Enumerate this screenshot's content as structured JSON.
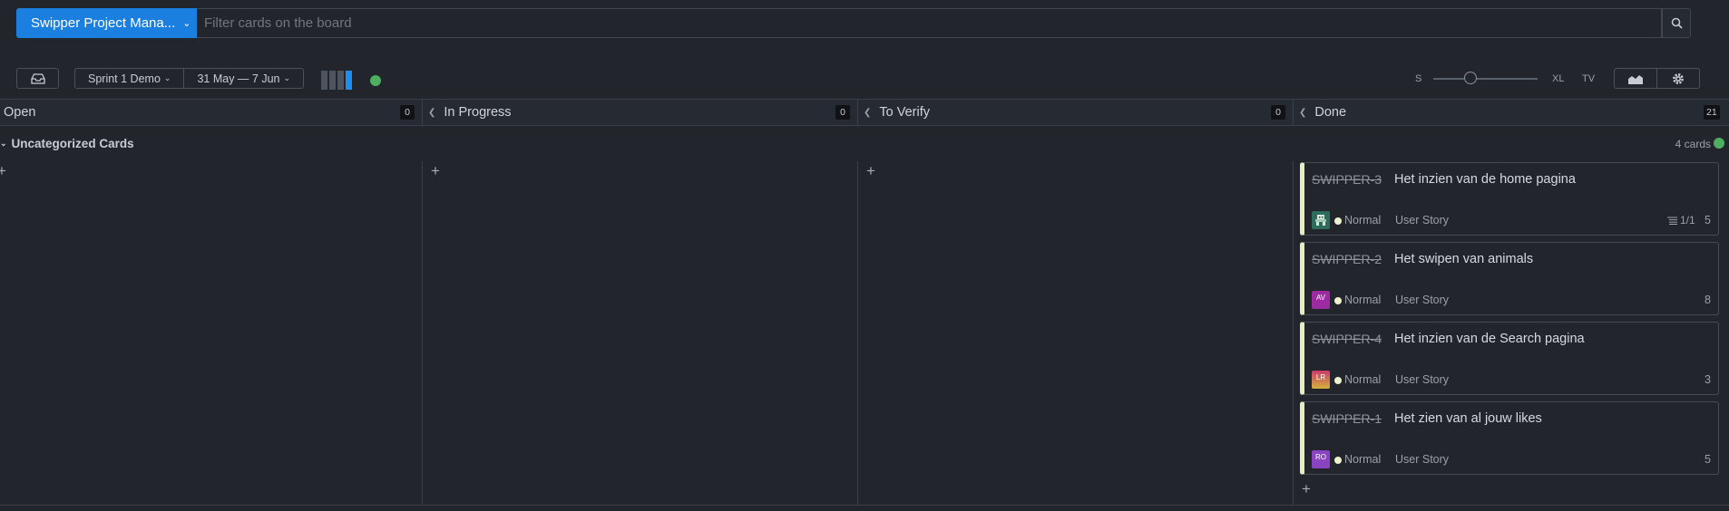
{
  "topbar": {
    "project_label": "Swipper Project Mana...",
    "search_placeholder": "Filter cards on the board"
  },
  "toolbar": {
    "sprint_label": "Sprint 1 Demo",
    "date_range": "31 May — 7 Jun",
    "size_small": "S",
    "size_xl": "XL",
    "size_tv": "TV",
    "zoom_level": 0.3
  },
  "columns": [
    {
      "name": "Open",
      "count": "0"
    },
    {
      "name": "In Progress",
      "count": "0"
    },
    {
      "name": "To Verify",
      "count": "0"
    },
    {
      "name": "Done",
      "count": "21"
    }
  ],
  "swimlane": {
    "title": "Uncategorized Cards",
    "count_label": "4 cards"
  },
  "cards": [
    {
      "id": "SWIPPER-3",
      "title": "Het inzien van de home pagina",
      "priority": "Normal",
      "type": "User Story",
      "tasks": "1/1",
      "points": "5",
      "avatar": "",
      "avatar_color": "#2f6b5a"
    },
    {
      "id": "SWIPPER-2",
      "title": "Het swipen van animals",
      "priority": "Normal",
      "type": "User Story",
      "points": "8",
      "avatar": "AV",
      "avatar_color": "#9c2aa0"
    },
    {
      "id": "SWIPPER-4",
      "title": "Het inzien van de Search pagina",
      "priority": "Normal",
      "type": "User Story",
      "points": "3",
      "avatar": "LR",
      "avatar_color": "#c9603a"
    },
    {
      "id": "SWIPPER-1",
      "title": "Het zien van al jouw likes",
      "priority": "Normal",
      "type": "User Story",
      "points": "5",
      "avatar": "RO",
      "avatar_color": "#8a44c2"
    }
  ],
  "colors": {
    "accent": "#1b7fe0",
    "card_stripe": "#e7edbf",
    "status_green": "#4caf62"
  },
  "icons": [
    "chevron-down-icon",
    "search-icon",
    "inbox-icon",
    "chart-icon",
    "gear-icon",
    "plus-icon",
    "chevron-left-icon",
    "list-icon"
  ]
}
